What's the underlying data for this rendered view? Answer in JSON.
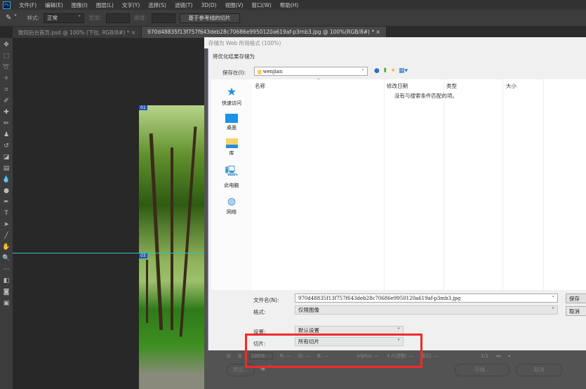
{
  "menubar": {
    "logo": "Ps",
    "items": [
      "文件(F)",
      "编辑(E)",
      "图像(I)",
      "图层(L)",
      "文字(Y)",
      "选择(S)",
      "滤镜(T)",
      "3D(D)",
      "视图(V)",
      "窗口(W)",
      "帮助(H)"
    ]
  },
  "options": {
    "style_label": "样式:",
    "style_value": "正常",
    "width_label": "宽度:",
    "height_label": "高度:",
    "slices_button": "基于参考线的切片"
  },
  "tabs": [
    {
      "label": "致同后台首页.psd @ 100% (下拉, RGB/8#) *",
      "close": "×"
    },
    {
      "label": "970d48835f13f757f643deb28c70686e9950120a619af-p3mb3.jpg @ 100%(RGB/8#) *",
      "close": "×"
    }
  ],
  "slices": [
    "01",
    "03"
  ],
  "dialog": {
    "title": "存储为 Web 所用格式 (100%)",
    "file_dialog": {
      "title": "将优化结果存储为",
      "save_in_label": "保存在(I):",
      "folder": "wenjian",
      "places": [
        "快速访问",
        "桌面",
        "库",
        "此电脑",
        "网络"
      ],
      "columns": [
        "名称",
        "修改日期",
        "类型",
        "大小"
      ],
      "empty_msg": "没有与搜索条件匹配的项。",
      "filename_label": "文件名(N):",
      "filename": "970d48835f13f757f643deb28c70686e9950120a619af-p3mb3.jpg",
      "format_label": "格式:",
      "format": "仅限图像",
      "save": "保存",
      "cancel": "取消",
      "settings_label": "设置:",
      "settings": "默认设置",
      "slices_label": "切片:",
      "slices": "所有切片"
    },
    "status": {
      "zoom": "100%",
      "r": "R: —",
      "g": "G: —",
      "b": "B: —",
      "alpha": "Alpha: —",
      "hex": "十六进制: —",
      "index": "索引: —",
      "page": "1/1"
    },
    "buttons": {
      "preview": "预览...",
      "save": "存储...",
      "cancel": "取消"
    }
  }
}
